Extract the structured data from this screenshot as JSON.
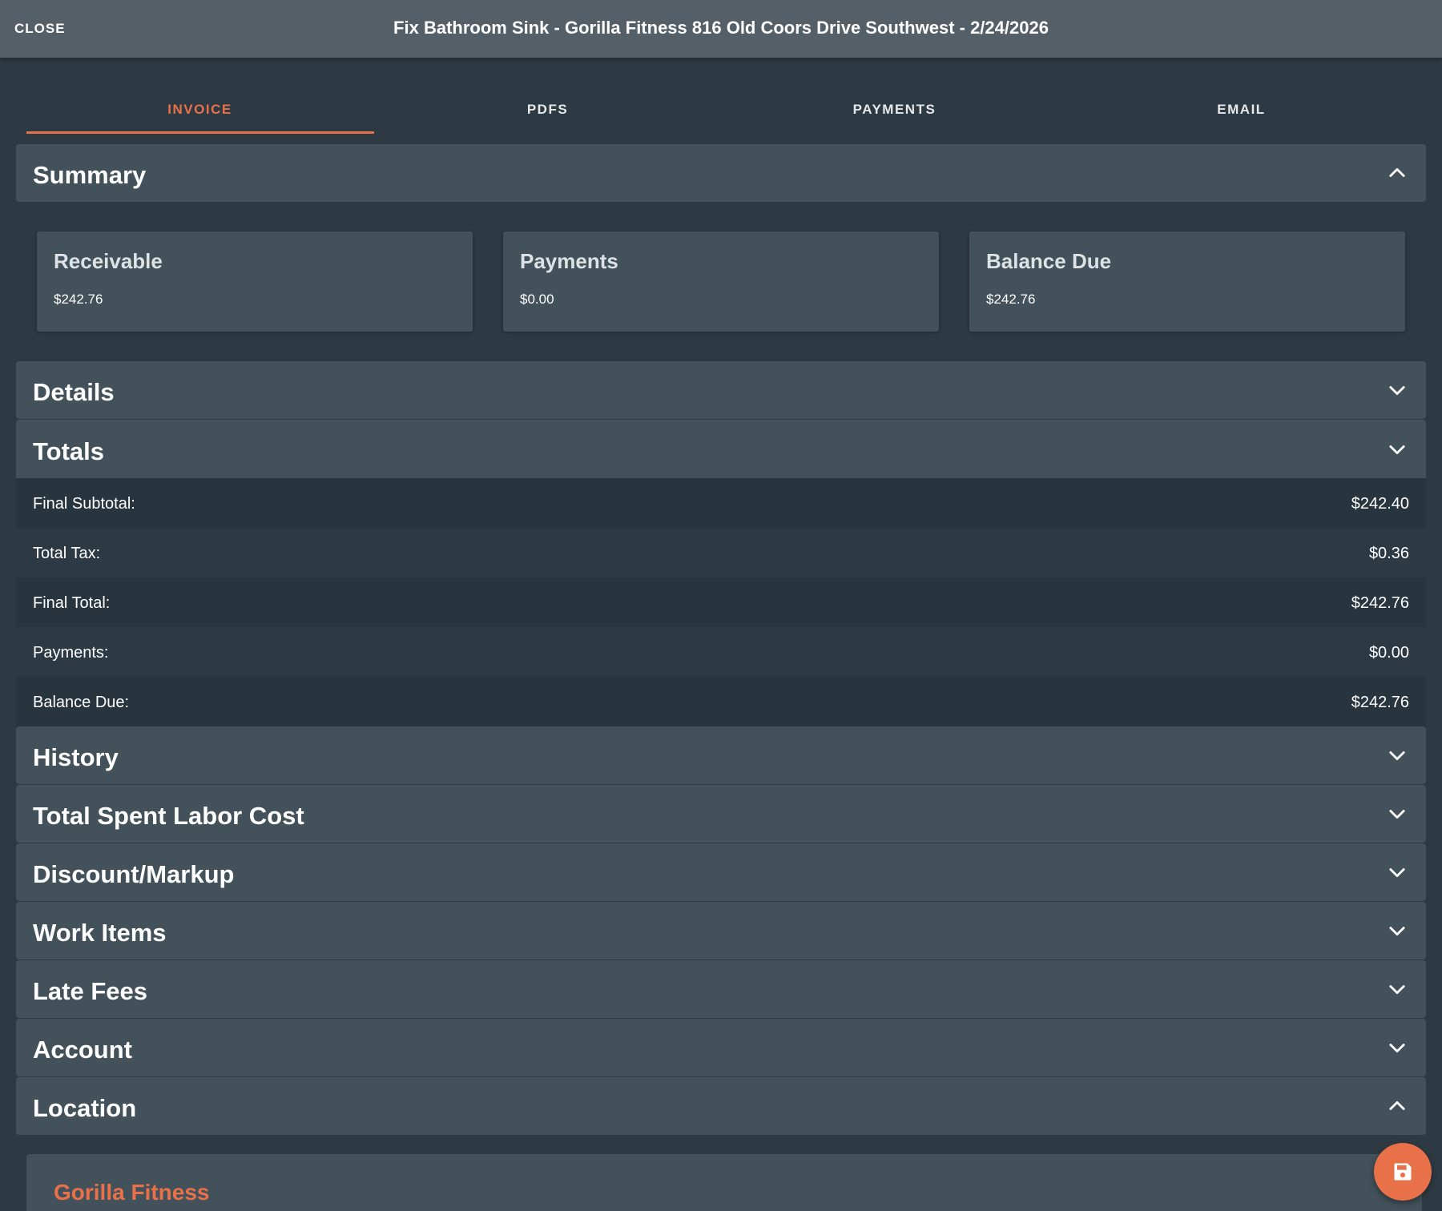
{
  "header": {
    "close_label": "CLOSE",
    "title": "Fix Bathroom Sink - Gorilla Fitness 816 Old Coors Drive Southwest - 2/24/2026"
  },
  "tabs": [
    {
      "label": "INVOICE",
      "active": true
    },
    {
      "label": "PDFS",
      "active": false
    },
    {
      "label": "PAYMENTS",
      "active": false
    },
    {
      "label": "EMAIL",
      "active": false
    }
  ],
  "summary": {
    "title": "Summary",
    "expanded": true,
    "cards": [
      {
        "title": "Receivable",
        "value": "$242.76"
      },
      {
        "title": "Payments",
        "value": "$0.00"
      },
      {
        "title": "Balance Due",
        "value": "$242.76"
      }
    ]
  },
  "details": {
    "title": "Details",
    "expanded": false
  },
  "totals": {
    "title": "Totals",
    "rows": [
      {
        "label": "Final Subtotal:",
        "value": "$242.40"
      },
      {
        "label": "Total Tax:",
        "value": "$0.36"
      },
      {
        "label": "Final Total:",
        "value": "$242.76"
      },
      {
        "label": "Payments:",
        "value": "$0.00"
      },
      {
        "label": "Balance Due:",
        "value": "$242.76"
      }
    ]
  },
  "sections": [
    {
      "title": "History",
      "expanded": false
    },
    {
      "title": "Total Spent Labor Cost",
      "expanded": false
    },
    {
      "title": "Discount/Markup",
      "expanded": false
    },
    {
      "title": "Work Items",
      "expanded": false
    },
    {
      "title": "Late Fees",
      "expanded": false
    },
    {
      "title": "Account",
      "expanded": false
    },
    {
      "title": "Location",
      "expanded": true
    }
  ],
  "location": {
    "name": "Gorilla Fitness"
  },
  "icons": {
    "chevron_down": "chevron-down-icon",
    "chevron_up": "chevron-up-icon",
    "save": "save-icon"
  },
  "colors": {
    "accent": "#e8714a",
    "background": "#2e3a43",
    "panel": "#43515a",
    "topbar": "#555f68"
  }
}
